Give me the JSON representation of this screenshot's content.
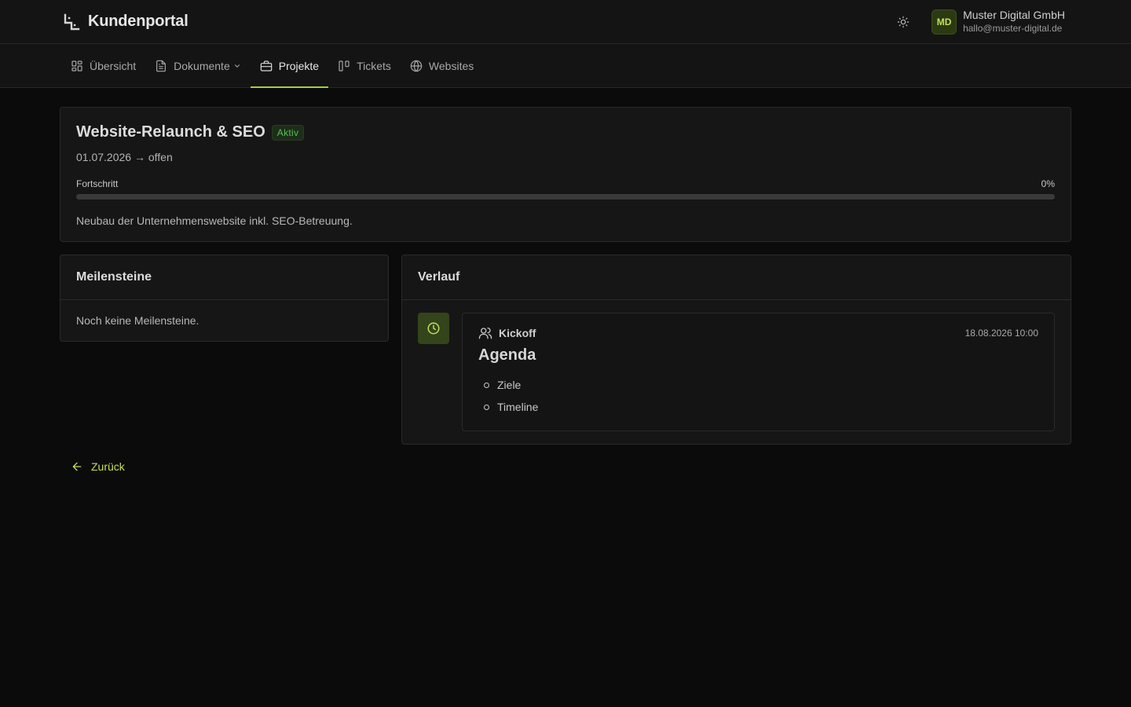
{
  "header": {
    "brand": "Kundenportal",
    "user": {
      "initials": "MD",
      "name": "Muster Digital GmbH",
      "email": "hallo@muster-digital.de"
    }
  },
  "nav": {
    "items": [
      {
        "label": "Übersicht",
        "icon": "dashboard-icon"
      },
      {
        "label": "Dokumente",
        "icon": "document-icon"
      },
      {
        "label": "Projekte",
        "icon": "briefcase-icon"
      },
      {
        "label": "Tickets",
        "icon": "kanban-icon"
      },
      {
        "label": "Websites",
        "icon": "globe-icon"
      }
    ],
    "active": "Projekte"
  },
  "project": {
    "title": "Website-Relaunch & SEO",
    "status": "Aktiv",
    "dates": "01.07.2026 → offen",
    "progress_label": "Fortschritt",
    "progress_value_label": "0%",
    "progress_fraction": 0,
    "description": "Neubau der Unternehmenswebsite inkl. SEO-Betreuung."
  },
  "milestones": {
    "title": "Meilensteine",
    "empty": "Noch keine Meilensteine."
  },
  "history": {
    "title": "Verlauf",
    "entries": [
      {
        "type": "Kickoff",
        "time": "18.08.2026 10:00",
        "title": "Agenda",
        "items": [
          "Ziele",
          "Timeline"
        ]
      }
    ]
  },
  "back_label": "Zurück",
  "colors": {
    "accent": "#a3cf3e",
    "status_active": "#4fc14f",
    "background": "#0b0b0b"
  }
}
